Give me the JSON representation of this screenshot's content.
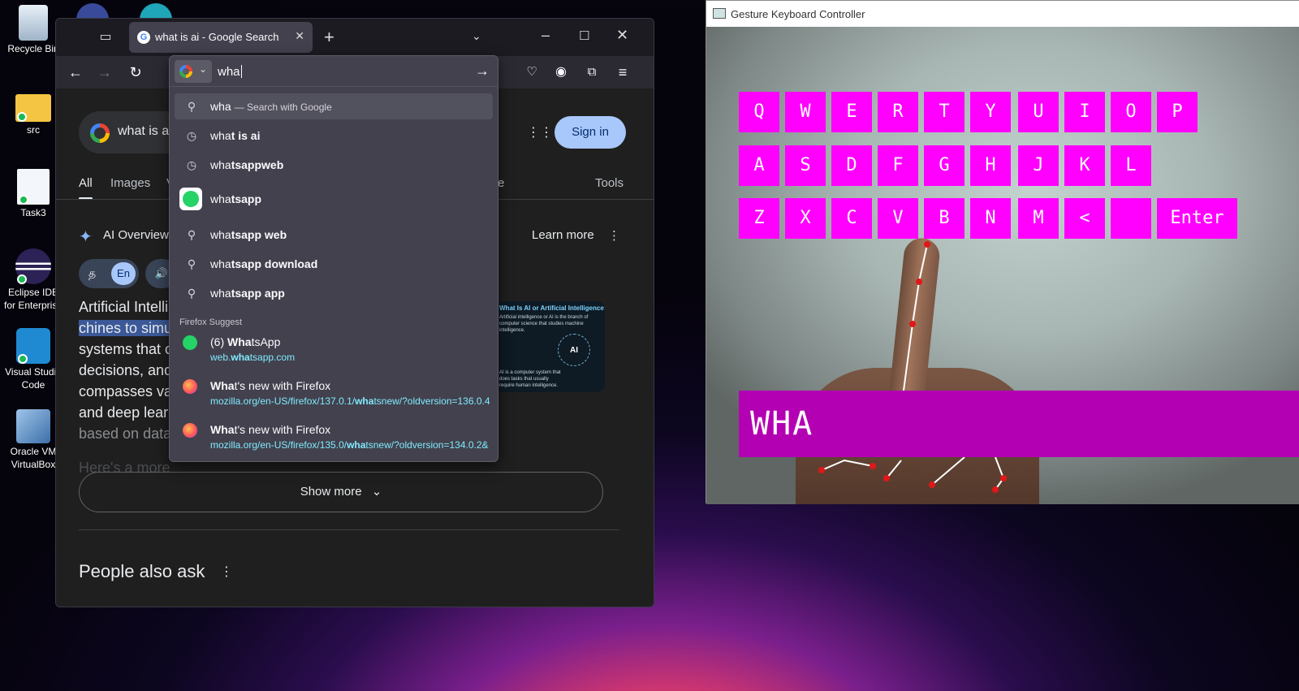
{
  "desktop": {
    "icons": [
      {
        "label": "Recycle Bin"
      },
      {
        "label": "src"
      },
      {
        "label": "Task3"
      },
      {
        "label": "Eclipse IDE for Enterprise"
      },
      {
        "label": "Visual Studio Code"
      },
      {
        "label": "Oracle VM VirtualBox"
      }
    ]
  },
  "firefox": {
    "tab_title": "what is ai - Google Search",
    "urlbar": {
      "value": "wha",
      "suggestions": [
        {
          "typed": "wha",
          "rest": "",
          "sub": "— Search with Google",
          "icon": "search-icon"
        },
        {
          "typed": "wha",
          "rest": "t is ai",
          "icon": "history-icon"
        },
        {
          "typed": "wha",
          "rest": "tsappweb",
          "icon": "history-icon"
        },
        {
          "typed": "wha",
          "rest": "tsapp",
          "icon": "whatsapp-icon"
        },
        {
          "typed": "wha",
          "rest": "tsapp web",
          "icon": "search-icon"
        },
        {
          "typed": "wha",
          "rest": "tsapp download",
          "icon": "search-icon"
        },
        {
          "typed": "wha",
          "rest": "tsapp app",
          "icon": "search-icon"
        }
      ],
      "section_label": "Firefox Suggest",
      "suggest": [
        {
          "title_pre": "(6) ",
          "title_bold": "Wha",
          "title_post": "tsApp",
          "url_pre": "web.",
          "url_bold": "wha",
          "url_post": "tsapp.com",
          "icon": "whatsapp-icon"
        },
        {
          "title_pre": "",
          "title_bold": "Wha",
          "title_post": "t's new with Firefox",
          "url_pre": "mozilla.org/en-US/firefox/137.0.1/",
          "url_bold": "wha",
          "url_post": "tsnew/?oldversion=136.0.4",
          "icon": "firefox-icon"
        },
        {
          "title_pre": "",
          "title_bold": "Wha",
          "title_post": "t's new with Firefox",
          "url_pre": "mozilla.org/en-US/firefox/135.0/",
          "url_bold": "wha",
          "url_post": "tsnew/?oldversion=134.0.2&",
          "icon": "firefox-icon"
        }
      ]
    },
    "google": {
      "query": "what is a",
      "sign_in": "Sign in",
      "tabs": {
        "all": "All",
        "images": "Images",
        "v": "V",
        "e": "e",
        "tools": "Tools"
      },
      "ai_overview": "AI Overview",
      "learn_more": "Learn more",
      "lang_ta": "த",
      "lang_en": "En",
      "ai_lines": [
        "Artificial Intelli",
        "chines to simu",
        "systems that c",
        "decisions, and",
        "compasses va",
        "and deep lear",
        "based on data",
        "Here's a more"
      ],
      "thumb_title": "What Is AI or Artificial Intelligence?",
      "thumb_text": "Artificial intelligence or AI is the branch of computer science that studies machine intelligence.",
      "thumb_badge": "AI",
      "thumb_bottom": "AI is a computer system that does tasks that usually require human intelligence.",
      "show_more": "Show more",
      "people_also_ask": "People also ask"
    }
  },
  "gesture": {
    "title": "Gesture Keyboard Controller",
    "row1": [
      "Q",
      "W",
      "E",
      "R",
      "T",
      "Y",
      "U",
      "I",
      "O",
      "P"
    ],
    "row2": [
      "A",
      "S",
      "D",
      "F",
      "G",
      "H",
      "J",
      "K",
      "L"
    ],
    "row3": [
      "Z",
      "X",
      "C",
      "V",
      "B",
      "N",
      "M",
      "<",
      " ",
      "Enter"
    ],
    "typed": "WHA",
    "colors": {
      "key": "#ff00ff",
      "typed_bg": "#b300b3"
    }
  }
}
